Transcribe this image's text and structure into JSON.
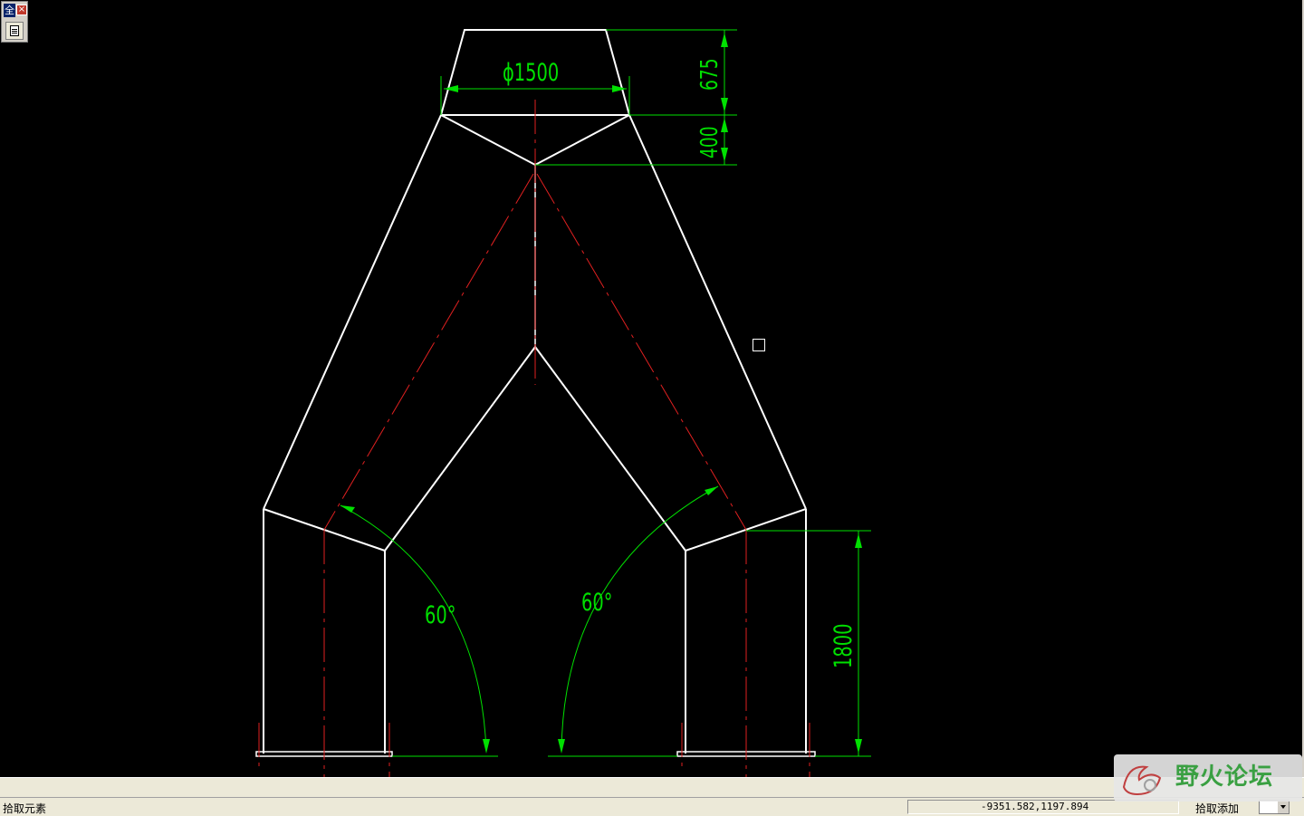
{
  "quick_bar": {
    "label": "全",
    "close": "×"
  },
  "dimensions": {
    "diameter": "ϕ1500",
    "top_height": "675",
    "cone_height": "400",
    "leg_height": "1800",
    "angle_left": "60°",
    "angle_right": "60°"
  },
  "colors": {
    "outline": "#ffffff",
    "centerline": "#e02020",
    "dimension": "#00e000",
    "background": "#000000"
  },
  "watermark": {
    "text": "野火论坛"
  },
  "status": {
    "left": "拾取元素",
    "coords": "-9351.582,1197.894",
    "mode": "拾取添加"
  }
}
